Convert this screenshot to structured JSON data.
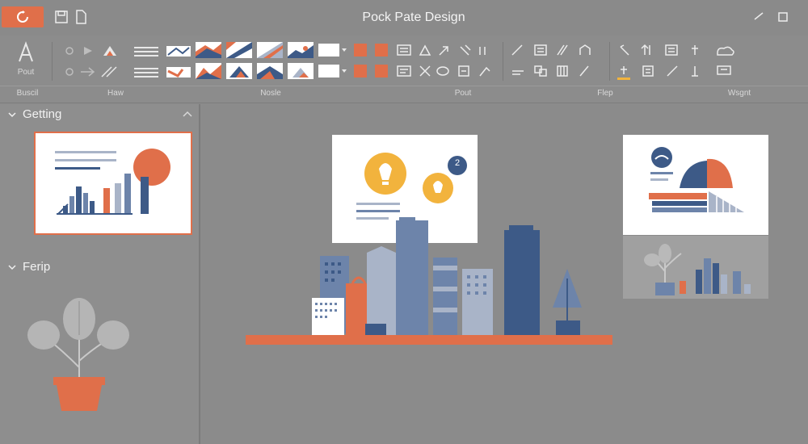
{
  "window": {
    "title": "Pock Pate Design"
  },
  "ribbon": {
    "groups": [
      "Buscil",
      "Haw",
      "Nosle",
      "Pout",
      "Flep",
      "Wsgnt"
    ],
    "first_tool_caption": "Pout"
  },
  "left_panel": {
    "sections": [
      {
        "label": "Getting"
      },
      {
        "label": "Ferip"
      }
    ]
  },
  "colors": {
    "accent": "#e06f4a",
    "navy": "#3d5a87",
    "steel": "#6d84aa",
    "light_steel": "#a9b4c8",
    "amber": "#f2b33d",
    "background": "#8b8b8b"
  },
  "slide_badge": "2"
}
